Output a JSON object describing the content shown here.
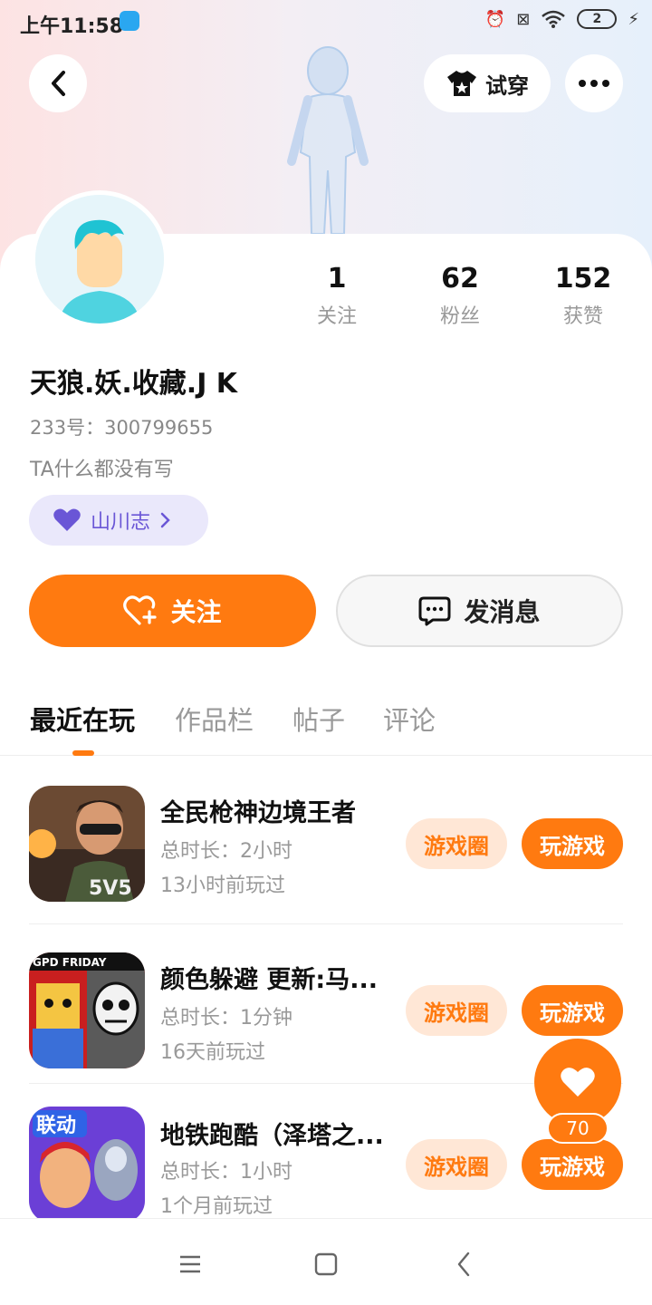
{
  "status_bar": {
    "time": "上午11:58",
    "battery": "2"
  },
  "header": {
    "tryon_label": "试穿"
  },
  "profile": {
    "stats": [
      {
        "value": "1",
        "label": "关注"
      },
      {
        "value": "62",
        "label": "粉丝"
      },
      {
        "value": "152",
        "label": "获赞"
      }
    ],
    "username": "天狼.妖.收藏.J K",
    "uid": "233号：300799655",
    "bio": "TA什么都没有写",
    "journal_label": "山川志"
  },
  "actions": {
    "follow_label": "关注",
    "message_label": "发消息"
  },
  "tabs": [
    {
      "label": "最近在玩",
      "active": true
    },
    {
      "label": "作品栏",
      "active": false
    },
    {
      "label": "帖子",
      "active": false
    },
    {
      "label": "评论",
      "active": false
    }
  ],
  "games": [
    {
      "name": "全民枪神边境王者",
      "duration": "总时长：2小时",
      "last_played": "13小时前玩过",
      "circle_label": "游戏圈",
      "play_label": "玩游戏",
      "icon_text": "5V5"
    },
    {
      "name": "颜色躲避 更新:马...",
      "duration": "总时长：1分钟",
      "last_played": "16天前玩过",
      "circle_label": "游戏圈",
      "play_label": "玩游戏",
      "icon_text": "GPD FRIDAY"
    },
    {
      "name": "地铁跑酷（泽塔之...",
      "duration": "总时长：1小时",
      "last_played": "1个月前玩过",
      "circle_label": "游戏圈",
      "play_label": "玩游戏",
      "icon_text": "联动"
    }
  ],
  "fab": {
    "count": "70"
  },
  "colors": {
    "accent": "#ff7a10",
    "accent_light": "#ffe7d6",
    "journal": "#6a56d6"
  }
}
